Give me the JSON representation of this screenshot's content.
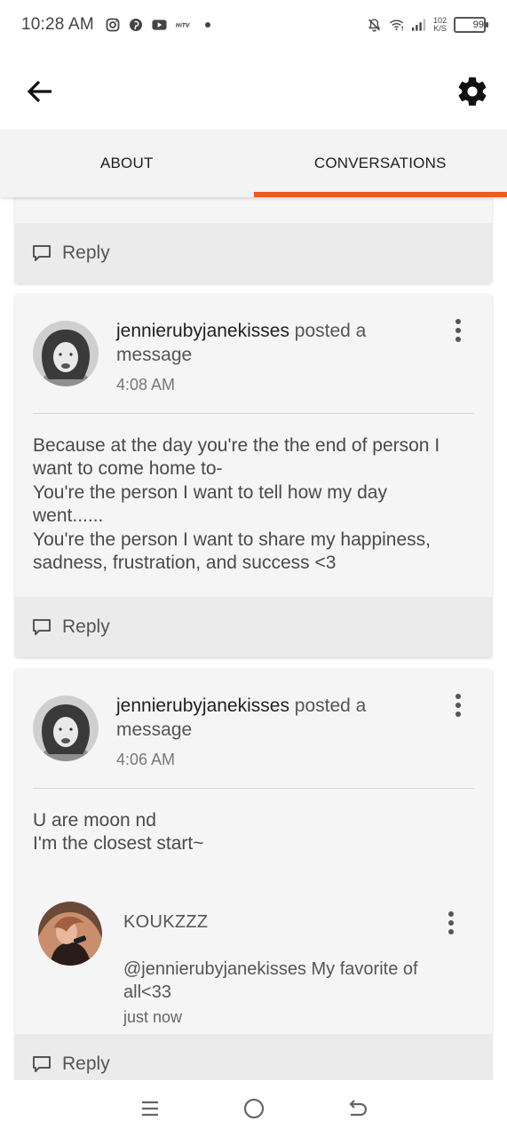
{
  "status_bar": {
    "time": "10:28 AM",
    "net_speed_value": "102",
    "net_speed_unit": "K/S",
    "battery": "99",
    "battery_level": 0.99,
    "app_icons": [
      "instagram-icon",
      "pinterest-icon",
      "youtube-icon",
      "hitv-icon"
    ]
  },
  "tabs": [
    {
      "label": "ABOUT",
      "active": false
    },
    {
      "label": "CONVERSATIONS",
      "active": true
    }
  ],
  "accent_color": "#ee5a24",
  "reply_label": "Reply",
  "posts": [
    {
      "username": "jennierubyjanekisses",
      "action_line1": "posted a",
      "action_line2": "message",
      "time": "4:08 AM",
      "message_lines": [
        "Because at the day you're the the end of person I",
        "want to come home to-",
        "You're the person I want to tell how my day",
        "went......",
        "You're the person I want to share my happiness,",
        "sadness, frustration, and success <3"
      ]
    },
    {
      "username": "jennierubyjanekisses",
      "action_line1": "posted a",
      "action_line2": "message",
      "time": "4:06 AM",
      "message_lines": [
        "U are moon nd",
        "I'm the closest start~"
      ],
      "comment": {
        "username": "KOUKZZZ",
        "text": "@jennierubyjanekisses My favorite of all<33",
        "time": "just now"
      }
    }
  ]
}
